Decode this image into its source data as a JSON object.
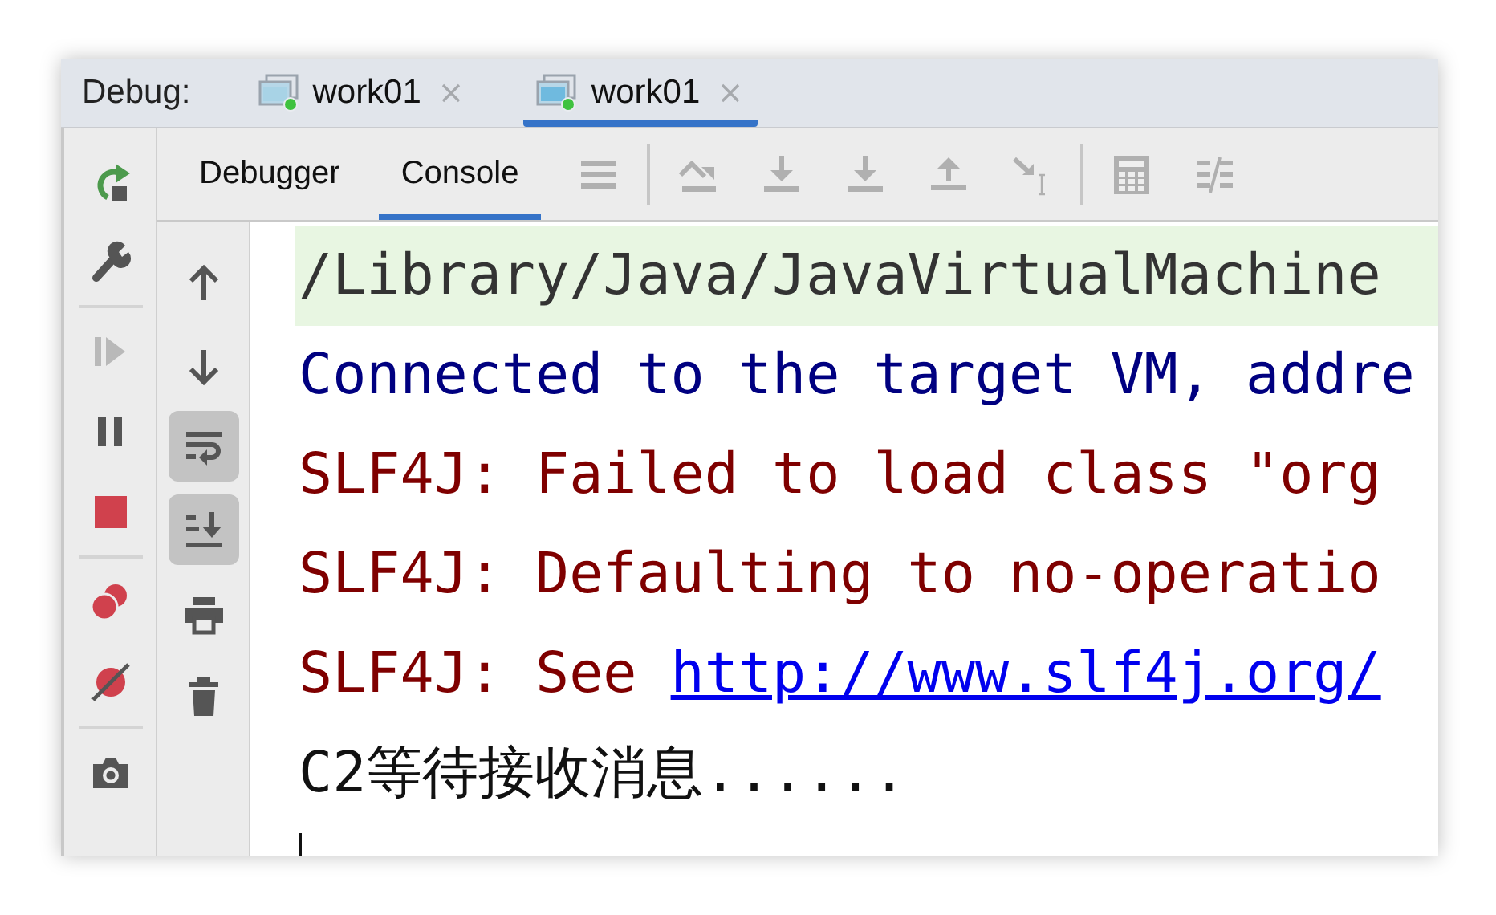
{
  "debug_bar": {
    "label": "Debug:",
    "tabs": [
      {
        "title": "work01",
        "selected": false
      },
      {
        "title": "work01",
        "selected": true
      }
    ]
  },
  "tool_tabs": [
    {
      "label": "Debugger",
      "selected": false
    },
    {
      "label": "Console",
      "selected": true
    }
  ],
  "side_toolbar": {
    "resume_disabled": true
  },
  "console_toolbar": {
    "soft_wrap_on": true,
    "scroll_to_end_on": true
  },
  "console": {
    "lines": [
      {
        "kind": "command",
        "text": "/Library/Java/JavaVirtualMachine"
      },
      {
        "kind": "system",
        "text": "Connected to the target VM, addre"
      },
      {
        "kind": "error",
        "text": "SLF4J: Failed to load class \"org"
      },
      {
        "kind": "error",
        "text": "SLF4J: Defaulting to no-operatio"
      },
      {
        "kind": "error",
        "text": "SLF4J: See ",
        "link": "http://www.slf4j.org/"
      },
      {
        "kind": "output",
        "text": "C2等待接收消息......"
      }
    ]
  }
}
